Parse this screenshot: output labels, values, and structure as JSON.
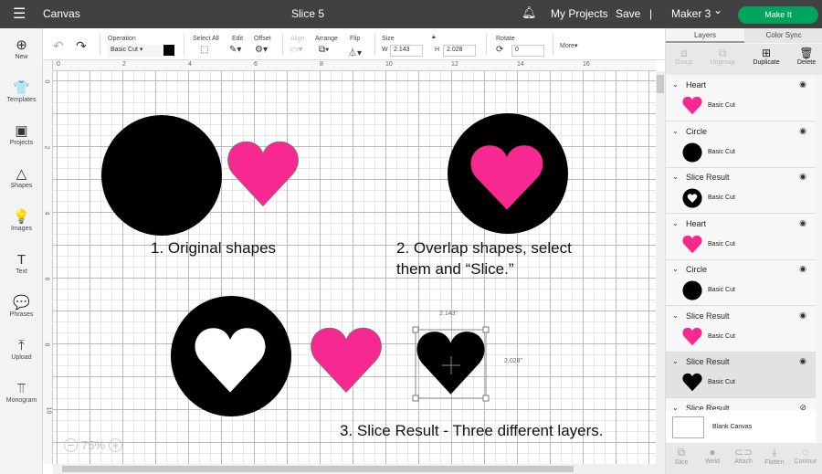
{
  "topbar": {
    "menu_icon": "hamburger-icon",
    "section": "Canvas",
    "project_title": "Slice 5",
    "bell_icon": "bell-icon",
    "my_projects": "My Projects",
    "save": "Save",
    "separator": "|",
    "machine": "Maker 3",
    "machine_chevron": "⌄",
    "make_it": "Make It",
    "accent": "#00a45d"
  },
  "sidebar": {
    "items": [
      {
        "label": "New",
        "icon": "plus-circle-icon",
        "glyph": "⊕"
      },
      {
        "label": "Templates",
        "icon": "shirt-icon",
        "glyph": "👕"
      },
      {
        "label": "Projects",
        "icon": "projects-icon",
        "glyph": "▣"
      },
      {
        "label": "Shapes",
        "icon": "shapes-icon",
        "glyph": "△"
      },
      {
        "label": "Images",
        "icon": "lightbulb-icon",
        "glyph": "💡"
      },
      {
        "label": "Text",
        "icon": "text-icon",
        "glyph": "T"
      },
      {
        "label": "Phrases",
        "icon": "speech-bubble-icon",
        "glyph": "💬"
      },
      {
        "label": "Upload",
        "icon": "upload-icon",
        "glyph": "⤒"
      },
      {
        "label": "Monogram",
        "icon": "monogram-icon",
        "glyph": "⫪"
      }
    ]
  },
  "toolbar": {
    "undo": "↶",
    "redo": "↷",
    "operation_label": "Operation",
    "operation_value": "Basic Cut",
    "operation_color": "#000000",
    "select_all": "Select All",
    "edit": "Edit",
    "offset": "Offset",
    "align": "Align",
    "arrange": "Arrange",
    "flip": "Flip",
    "size": "Size",
    "w_label": "W",
    "w_value": "2.143",
    "h_label": "H",
    "h_value": "2.028",
    "rotate": "Rotate",
    "rotate_value": "0",
    "more": "More▾"
  },
  "ruler": {
    "top": [
      "0",
      "2",
      "4",
      "6",
      "8",
      "10",
      "12",
      "14",
      "16"
    ],
    "left": [
      "0",
      "2",
      "4",
      "6",
      "8",
      "10"
    ]
  },
  "canvas": {
    "caption1": "1. Original shapes",
    "caption2_line1": "2. Overlap shapes, select",
    "caption2_line2": "them and “Slice.”",
    "caption3": "3. Slice Result - Three different layers.",
    "selection_width": "2.143\"",
    "selection_height": "2.028\"",
    "zoom_minus": "−",
    "zoom_level": "75%",
    "zoom_plus": "+",
    "pink": "#f7288f",
    "black": "#000000"
  },
  "panel": {
    "tab_layers": "Layers",
    "tab_color_sync": "Color Sync",
    "group": "Group",
    "ungroup": "Ungroup",
    "duplicate": "Duplicate",
    "delete": "Delete",
    "layers": [
      {
        "name": "Heart",
        "op": "Basic Cut",
        "thumb": "pink-heart",
        "hidden": false
      },
      {
        "name": "Circle",
        "op": "Basic Cut",
        "thumb": "black-circle",
        "hidden": false
      },
      {
        "name": "Slice Result",
        "op": "Basic Cut",
        "thumb": "circle-heart-cutout",
        "hidden": false
      },
      {
        "name": "Heart",
        "op": "Basic Cut",
        "thumb": "pink-heart",
        "hidden": false
      },
      {
        "name": "Circle",
        "op": "Basic Cut",
        "thumb": "black-circle",
        "hidden": false
      },
      {
        "name": "Slice Result",
        "op": "Basic Cut",
        "thumb": "pink-heart",
        "hidden": false
      },
      {
        "name": "Slice Result",
        "op": "Basic Cut",
        "thumb": "black-heart",
        "hidden": false,
        "selected": true
      },
      {
        "name": "Slice Result",
        "op": "",
        "thumb": "",
        "hidden": true
      }
    ],
    "blank_canvas": "Blank Canvas",
    "bottom_tools": [
      "Slice",
      "Weld",
      "Attach",
      "Flatten",
      "Contour"
    ]
  }
}
